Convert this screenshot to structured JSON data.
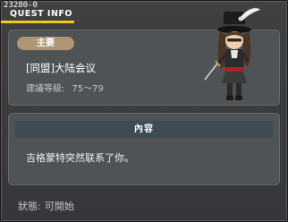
{
  "header": {
    "quest_id": "23280-0",
    "title": "QUEST INFO"
  },
  "quest": {
    "badge": "主要",
    "name": "[同盟]大陆会议",
    "level_label": "建議等級:",
    "level_range": "75～79"
  },
  "content": {
    "header": "內容",
    "text": "吉格蒙特突然联系了你。"
  },
  "status": {
    "label": "狀態:",
    "value": "可開始"
  },
  "npc": {
    "name_icon": "npc-character-icon"
  },
  "colors": {
    "title_accent": "#f6c90f",
    "badge": "#ae9677",
    "content_header": "#3e4b54"
  }
}
